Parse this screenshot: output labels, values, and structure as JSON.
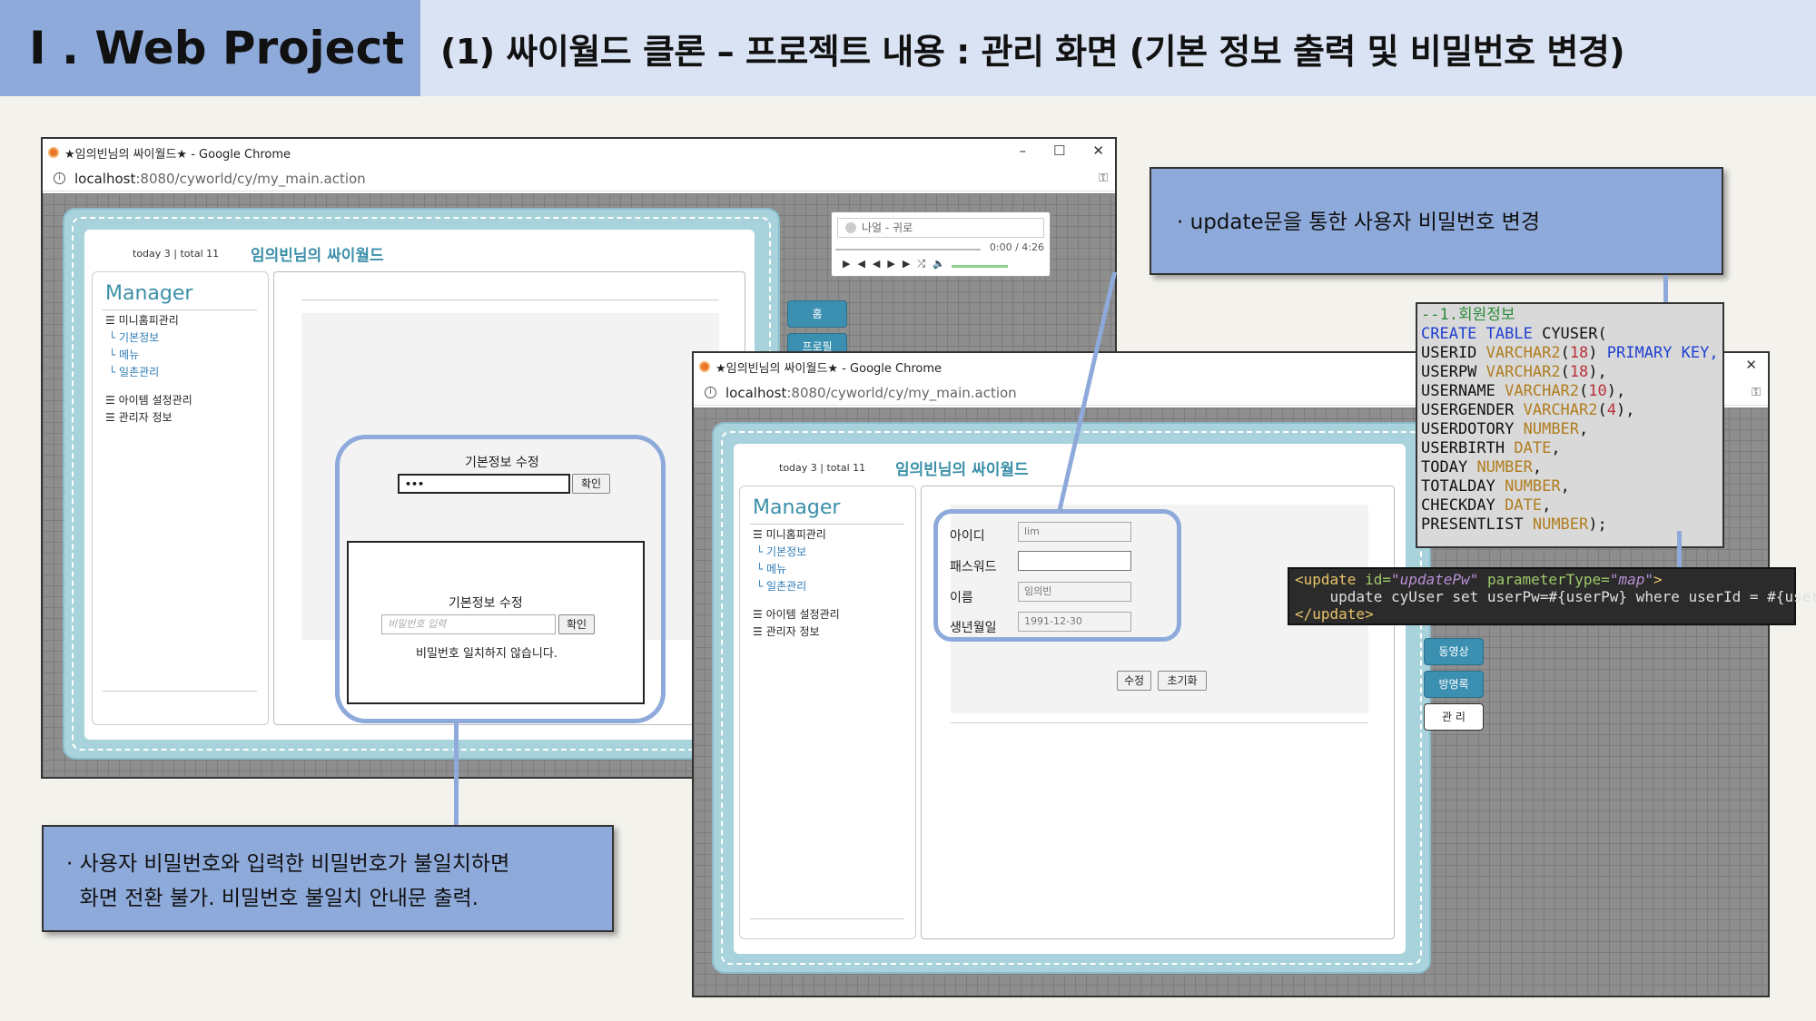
{
  "header": {
    "section": "I . Web Project",
    "title": "(1) 싸이월드 클론 – 프로젝트 내용 : 관리 화면 (기본 정보 출력 및 비밀번호 변경)"
  },
  "browser": {
    "tab_title": "★임의빈님의 싸이월드★ - Google Chrome",
    "url_host": "localhost",
    "url_path": ":8080/cyworld/cy/my_main.action",
    "controls": {
      "minimize": "–",
      "maximize": "☐",
      "close": "✕"
    }
  },
  "homepage": {
    "today": "today 3 | total 11",
    "site_title": "임의빈님의 싸이월드",
    "manager_label": "Manager",
    "menu": {
      "home_admin": "미니홈피관리",
      "basic_info": "기본정보",
      "menu": "메뉴",
      "diary": "일촌관리",
      "item": "아이템 설정관리",
      "admin_info": "관리자 정보"
    },
    "tabs": {
      "home": "홈",
      "profile": "프로필",
      "video": "동영상",
      "guestbook": "방명록",
      "admin": "관 리"
    }
  },
  "player": {
    "song": "나얼 - 귀로",
    "time": "0:00 / 4:26"
  },
  "left_window": {
    "edit_title": "기본정보 수정",
    "password_value": "•••",
    "confirm": "확인",
    "dialog_title": "기본정보 수정",
    "dialog_placeholder": "비밀번호 입력",
    "dialog_confirm": "확인",
    "error_msg": "비밀번호 일치하지 않습니다."
  },
  "right_window": {
    "id_label": "아이디",
    "id_value": "lim",
    "pw_label": "패스워드",
    "pw_value": "",
    "name_label": "이름",
    "name_value": "임의빈",
    "birth_label": "생년월일",
    "birth_value": "1991-12-30",
    "edit_btn": "수정",
    "reset_btn": "초기화"
  },
  "callouts": {
    "top": "· update문을 통한 사용자 비밀번호 변경",
    "bottom_line1": "· 사용자 비밀번호와 입력한 비밀번호가 불일치하면",
    "bottom_line2": "  화면 전환 불가. 비밀번호 불일치 안내문 출력."
  },
  "sql": {
    "comment": "--1.회원정보",
    "create": "CREATE TABLE",
    "table": "CYUSER(",
    "cols": [
      {
        "name": "USERID",
        "type": "VARCHAR2",
        "size": "18",
        "extra": "PRIMARY KEY,"
      },
      {
        "name": "USERPW",
        "type": "VARCHAR2",
        "size": "18",
        "extra": ","
      },
      {
        "name": "USERNAME",
        "type": "VARCHAR2",
        "size": "10",
        "extra": ","
      },
      {
        "name": "USERGENDER",
        "type": "VARCHAR2",
        "size": "4",
        "extra": ","
      },
      {
        "name": "USERDOTORY",
        "type": "NUMBER",
        "size": "",
        "extra": ","
      },
      {
        "name": "USERBIRTH",
        "type": "DATE",
        "size": "",
        "extra": ","
      },
      {
        "name": "TODAY",
        "type": "NUMBER",
        "size": "",
        "extra": ","
      },
      {
        "name": "TOTALDAY",
        "type": "NUMBER",
        "size": "",
        "extra": ","
      },
      {
        "name": "CHECKDAY",
        "type": "DATE",
        "size": "",
        "extra": ","
      },
      {
        "name": "PRESENTLIST",
        "type": "NUMBER",
        "size": "",
        "extra": ");"
      }
    ]
  },
  "mybatis": {
    "open_tag": "<update",
    "id_attr": "id=",
    "id_val": "\"updatePw\"",
    "pt_attr": "parameterType=",
    "pt_val": "\"map\"",
    "close_bracket": ">",
    "body": "    update cyUser set userPw=#{userPw} where userId = #{userId }",
    "end_tag": "</update>"
  }
}
